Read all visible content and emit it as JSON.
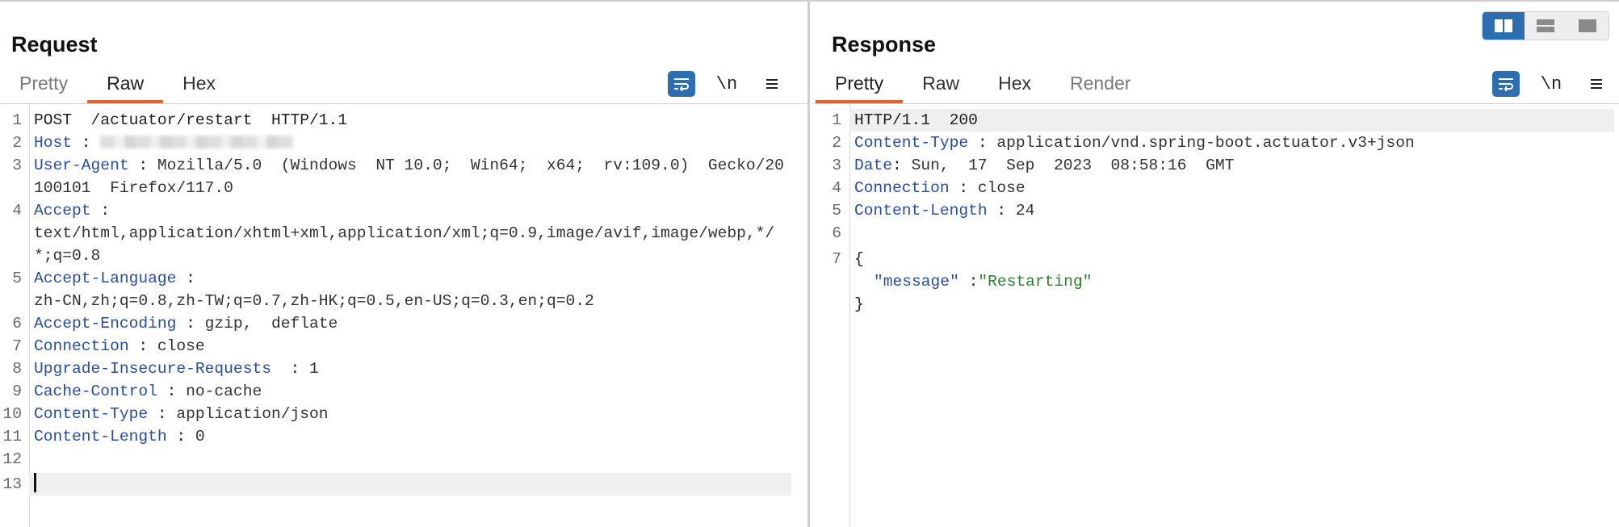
{
  "request": {
    "title": "Request",
    "tabs": [
      "Pretty",
      "Raw",
      "Hex"
    ],
    "active_tab": "Raw",
    "toolbar": {
      "newline_label": "\\n"
    },
    "lines": [
      {
        "n": "1",
        "text": "POST  /actuator/restart  HTTP/1.1"
      },
      {
        "n": "2",
        "key": "Host",
        "value": " "
      },
      {
        "n": "3",
        "key": "User-Agent",
        "value": "Mozilla/5.0  (Windows  NT 10.0;  Win64;  x64;  rv:109.0)  Gecko/20100101  Firefox/117.0"
      },
      {
        "n": "4",
        "key": "Accept",
        "value": "text/html,application/xhtml+xml,application/xml;q=0.9,image/avif,image/webp,*/*;q=0.8"
      },
      {
        "n": "5",
        "key": "Accept-Language",
        "value": "zh-CN,zh;q=0.8,zh-TW;q=0.7,zh-HK;q=0.5,en-US;q=0.3,en;q=0.2"
      },
      {
        "n": "6",
        "key": "Accept-Encoding",
        "value": "gzip,  deflate"
      },
      {
        "n": "7",
        "key": "Connection",
        "value": "close"
      },
      {
        "n": "8",
        "key": "Upgrade-Insecure-Requests",
        "value": "1"
      },
      {
        "n": "9",
        "key": "Cache-Control",
        "value": "no-cache"
      },
      {
        "n": "10",
        "key": "Content-Type",
        "value": "application/json"
      },
      {
        "n": "11",
        "key": "Content-Length",
        "value": "0"
      },
      {
        "n": "12",
        "text": ""
      },
      {
        "n": "13",
        "text": ""
      }
    ]
  },
  "response": {
    "title": "Response",
    "tabs": [
      "Pretty",
      "Raw",
      "Hex",
      "Render"
    ],
    "active_tab": "Pretty",
    "toolbar": {
      "newline_label": "\\n"
    },
    "lines": [
      {
        "n": "1",
        "text": "HTTP/1.1  200"
      },
      {
        "n": "2",
        "key": "Content-Type",
        "value": "application/vnd.spring-boot.actuator.v3+json"
      },
      {
        "n": "3",
        "key": "Date",
        "value": "Sun,  17  Sep  2023  08:58:16  GMT"
      },
      {
        "n": "4",
        "key": "Connection",
        "value": "close"
      },
      {
        "n": "5",
        "key": "Content-Length",
        "value": "24"
      },
      {
        "n": "6",
        "text": ""
      },
      {
        "n": "7",
        "text": "{"
      },
      {
        "n": "",
        "json_key": "\"message\"",
        "json_value": "\"Restarting\""
      },
      {
        "n": "",
        "text": "}"
      }
    ]
  },
  "colors": {
    "accent_tab": "#e8612c",
    "active_button": "#2c6eb0",
    "header_key": "#2a4d9b",
    "json_string": "#2e7d32"
  },
  "icons": {
    "wrap": "wrap-lines-icon",
    "menu": "hamburger-menu-icon",
    "layout_side_by_side": "split-vertical-icon",
    "layout_stacked": "split-horizontal-icon",
    "layout_single": "single-pane-icon"
  }
}
